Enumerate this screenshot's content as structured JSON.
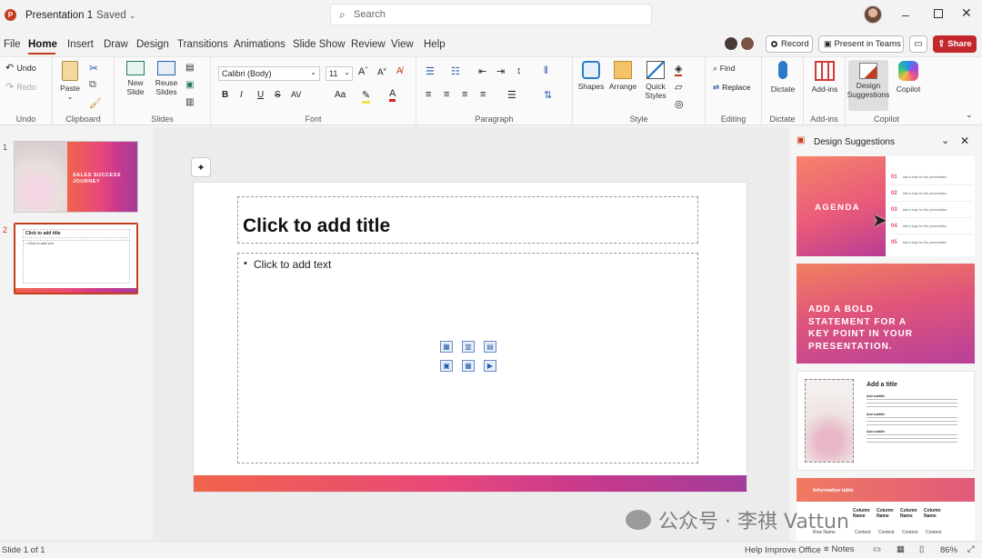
{
  "titlebar": {
    "app_title": "Presentation 1",
    "saved_label": "Saved",
    "search_placeholder": "Search"
  },
  "menu": {
    "tabs": [
      "File",
      "Home",
      "Insert",
      "Draw",
      "Design",
      "Transitions",
      "Animations",
      "Slide Show",
      "Review",
      "View",
      "Help"
    ],
    "active": "Home",
    "record_label": "Record",
    "present_label": "Present in Teams",
    "share_label": "Share"
  },
  "ribbon": {
    "undo": {
      "undo": "Undo",
      "redo": "Redo",
      "group": "Undo"
    },
    "clipboard": {
      "paste": "Paste",
      "group": "Clipboard"
    },
    "slides": {
      "new_slide": "New\nSlide",
      "reuse": "Reuse\nSlides",
      "group": "Slides"
    },
    "font": {
      "name": "Calibri (Body)",
      "size": "11",
      "group": "Font",
      "bold": "B",
      "italic": "I",
      "underline": "U",
      "strike": "S",
      "spacing": "AV",
      "case": "Aa"
    },
    "paragraph": {
      "group": "Paragraph"
    },
    "drawing": {
      "shapes": "Shapes",
      "arrange": "Arrange",
      "quick": "Quick\nStyles",
      "group": "Style"
    },
    "editing": {
      "find": "Find",
      "replace": "Replace",
      "group": "Editing"
    },
    "dictate": {
      "label": "Dictate",
      "group": "Dictate"
    },
    "addins": {
      "label": "Add-ins",
      "group": "Add-ins"
    },
    "designer": {
      "label": "Design\nSuggestions"
    },
    "copilot": {
      "label": "Copilot",
      "group": "Copilot"
    }
  },
  "thumbnails": [
    {
      "number": "1",
      "title": "SALES SUCCESS\nJOURNEY"
    },
    {
      "number": "2",
      "title": "Click to add title",
      "sub": "• Click to add text"
    }
  ],
  "slide": {
    "title_placeholder": "Click to add title",
    "body_placeholder": "Click to add text"
  },
  "design_panel": {
    "title": "Design Suggestions",
    "agenda_title": "AGENDA",
    "agenda_items": [
      {
        "num": "01",
        "text": "Add a topic for the presentation"
      },
      {
        "num": "02",
        "text": "Add a topic for the presentation"
      },
      {
        "num": "03",
        "text": "Add a topic for the presentation"
      },
      {
        "num": "04",
        "text": "Add a topic for the presentation"
      },
      {
        "num": "05",
        "text": "Add a topic for the presentation"
      }
    ],
    "bold_statement": "ADD A BOLD\nSTATEMENT FOR A\nKEY POINT IN YOUR\nPRESENTATION.",
    "add_title": "Add a title",
    "subtitle": "Add subtitle",
    "info_table": "Information table",
    "col_header": "Column\nName",
    "row_name": "Row Name",
    "content": "Content"
  },
  "status": {
    "slide_of": "Slide 1 of 1",
    "help": "Help Improve Office",
    "notes": "Notes",
    "zoom": "86%"
  },
  "watermark": "公众号 · 李祺 Vattun",
  "colors": {
    "accent": "#c43e1c",
    "share": "#c4262e",
    "grad_start": "#f0644a",
    "grad_end": "#a33c9a"
  }
}
